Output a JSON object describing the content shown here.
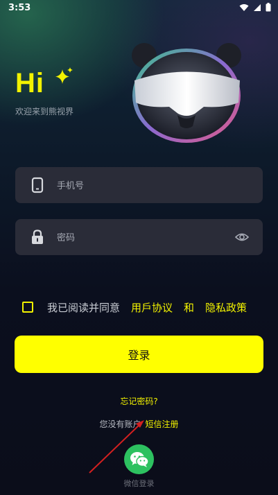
{
  "status_bar": {
    "time": "3:53",
    "icons": [
      "wifi-icon",
      "signal-icon",
      "battery-icon"
    ]
  },
  "header": {
    "hi_text": "Hi",
    "welcome_text": "欢迎来到熊视界"
  },
  "form": {
    "phone": {
      "placeholder": "手机号",
      "value": "",
      "icon": "phone-icon"
    },
    "password": {
      "placeholder": "密码",
      "value": "",
      "icon": "lock-icon",
      "toggle_icon": "eye-icon"
    }
  },
  "agreement": {
    "checked": false,
    "prefix": "我已阅读并同意",
    "user_agreement": "用戶协议",
    "and": "和",
    "privacy_policy": "隐私政策"
  },
  "login_button": {
    "label": "登录"
  },
  "forgot_password": "忘记密码?",
  "register": {
    "no_account": "您没有账户",
    "sms_register": "短信注册"
  },
  "wechat_login": {
    "label": "微信登录",
    "icon": "wechat-icon"
  },
  "colors": {
    "accent": "#ffff00",
    "field_bg": "#2a2c38",
    "wechat_green": "#2dc160",
    "annotation_arrow": "#d32020"
  }
}
